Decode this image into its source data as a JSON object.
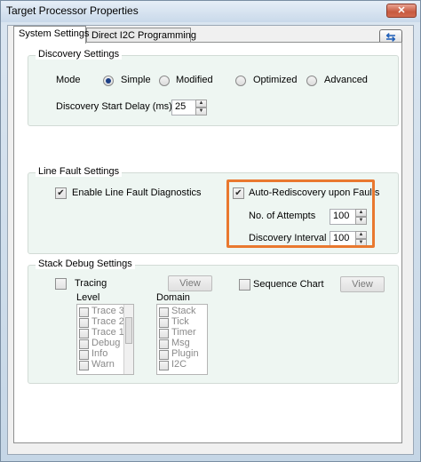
{
  "window": {
    "title": "Target Processor Properties",
    "close_glyph": "✕"
  },
  "tabs": [
    {
      "label": "System Settings",
      "active": true
    },
    {
      "label": "Direct I2C Programming",
      "active": false
    }
  ],
  "refresh_icon": "refresh-icon",
  "discovery": {
    "label": "Discovery Settings",
    "mode_label": "Mode",
    "modes": [
      {
        "label": "Simple",
        "checked": true
      },
      {
        "label": "Modified",
        "checked": false
      },
      {
        "label": "Optimized",
        "checked": false
      },
      {
        "label": "Advanced",
        "checked": false
      }
    ],
    "start_delay_label": "Discovery Start Delay (ms)",
    "start_delay_value": "25"
  },
  "line_fault": {
    "label": "Line Fault Settings",
    "enable_label": "Enable Line Fault Diagnostics",
    "enable_checked": true,
    "auto_label": "Auto-Rediscovery upon Faults",
    "auto_checked": true,
    "attempts_label": "No. of Attempts",
    "attempts_value": "100",
    "interval_label": "Discovery Interval (ms)",
    "interval_value": "100",
    "highlight_color": "#e9782f"
  },
  "stack_debug": {
    "label": "Stack Debug Settings",
    "tracing_label": "Tracing",
    "tracing_view": "View",
    "sequence_label": "Sequence Chart",
    "sequence_view": "View",
    "level_label": "Level",
    "level_items": [
      "Trace 3",
      "Trace 2",
      "Trace 1",
      "Debug",
      "Info",
      "Warn"
    ],
    "domain_label": "Domain",
    "domain_items": [
      "Stack",
      "Tick",
      "Timer",
      "Msg",
      "Plugin",
      "I2C"
    ]
  }
}
